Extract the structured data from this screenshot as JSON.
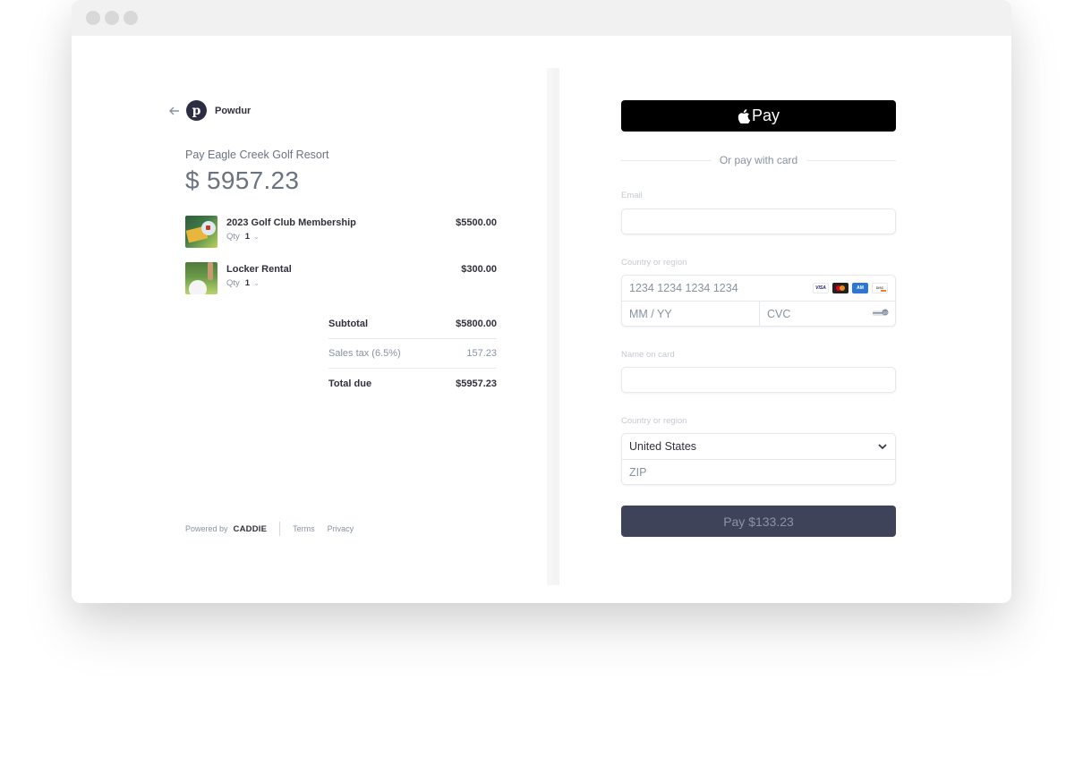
{
  "window": {
    "controls": [
      "close",
      "minimize",
      "maximize"
    ]
  },
  "merchant": {
    "back_icon": "arrow-left-icon",
    "logo_letter": "p",
    "name": "Powdur"
  },
  "summary": {
    "pay_to": "Pay Eagle Creek Golf Resort",
    "amount": "$ 5957.23",
    "items": [
      {
        "name": "2023 Golf Club Membership",
        "qty_label": "Qty",
        "qty": "1",
        "price": "$5500.00",
        "image": "golf-membership-card"
      },
      {
        "name": "Locker Rental",
        "qty_label": "Qty",
        "qty": "1",
        "price": "$300.00",
        "image": "golf-ball-on-tee"
      }
    ],
    "totals": [
      {
        "label": "Subtotal",
        "value": "$5800.00"
      },
      {
        "label": "Sales tax (6.5%)",
        "value": "157.23"
      },
      {
        "label": "Total due",
        "value": "$5957.23"
      }
    ]
  },
  "footer": {
    "powered_by": "Powered by",
    "brand": "CADDIE",
    "links": [
      "Terms",
      "Privacy"
    ]
  },
  "payment": {
    "apple_pay_label": "Pay",
    "divider_text": "Or pay with card",
    "email_label": "Email",
    "email_value": "",
    "card_label": "Country or region",
    "card_number_placeholder": "1234 1234 1234 1234",
    "expiry_placeholder": "MM / YY",
    "cvc_placeholder": "CVC",
    "card_brands": [
      "Visa",
      "Mastercard",
      "Amex",
      "Discover"
    ],
    "name_label": "Name on card",
    "name_value": "",
    "country_label": "Country or region",
    "country_selected": "United States",
    "zip_placeholder": "ZIP",
    "pay_button": "Pay $133.23"
  },
  "colors": {
    "pay_button_bg": "#3e4359",
    "apple_pay_bg": "#000000",
    "brand_logo_bg": "#2b2d42"
  }
}
